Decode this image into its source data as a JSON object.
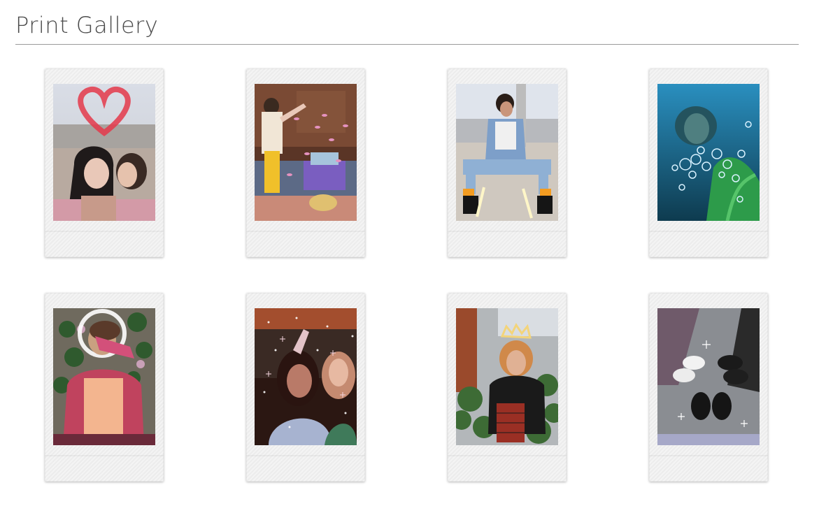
{
  "page": {
    "title": "Print Gallery"
  },
  "prints": [
    {
      "name": "heart-rooftop"
    },
    {
      "name": "petals-living-room"
    },
    {
      "name": "rooftop-denim"
    },
    {
      "name": "underwater-bubbles"
    },
    {
      "name": "halo-ivy"
    },
    {
      "name": "sparkle-selfie"
    },
    {
      "name": "crown-garden"
    },
    {
      "name": "shoes-sparkle"
    }
  ],
  "colors": {
    "title": "#4a4a4a",
    "rule": "#9a9a9a",
    "frame": "#f1f1f1"
  }
}
